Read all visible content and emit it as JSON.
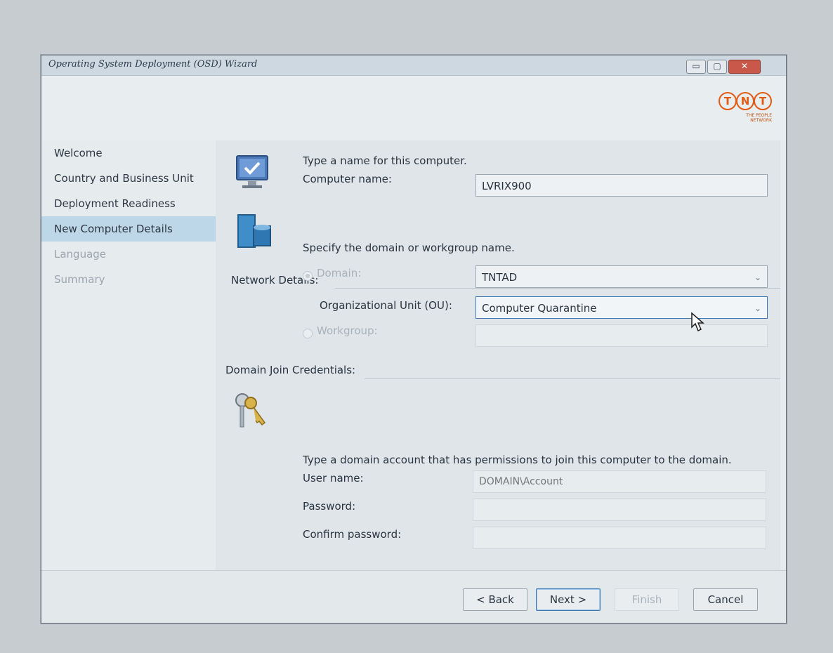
{
  "window": {
    "title": "Operating System Deployment (OSD) Wizard",
    "controls": {
      "minimize": "▭",
      "maximize": "▢",
      "close": "✕"
    }
  },
  "brand": {
    "letters": [
      "T",
      "N",
      "T"
    ],
    "tagline_1": "THE PEOPLE",
    "tagline_2": "NETWORK",
    "color": "#e25b14"
  },
  "nav": {
    "items": [
      {
        "label": "Welcome",
        "state": "normal"
      },
      {
        "label": "Country and Business Unit",
        "state": "normal"
      },
      {
        "label": "Deployment Readiness",
        "state": "normal"
      },
      {
        "label": "New Computer Details",
        "state": "active"
      },
      {
        "label": "Language",
        "state": "disabled"
      },
      {
        "label": "Summary",
        "state": "disabled"
      }
    ]
  },
  "computer": {
    "prompt": "Type a name for this computer.",
    "name_label": "Computer name:",
    "name_value": "LVRIX900",
    "icon": "monitor-check-icon"
  },
  "network": {
    "section_label": "Network Details:",
    "prompt": "Specify the domain or workgroup name.",
    "domain_label": "Domain:",
    "domain_value": "TNTAD",
    "ou_label": "Organizational Unit (OU):",
    "ou_value": "Computer Quarantine",
    "workgroup_label": "Workgroup:",
    "workgroup_value": "",
    "icon": "network-server-icon",
    "selected": "domain"
  },
  "credentials": {
    "section_label": "Domain Join Credentials:",
    "prompt": "Type a domain account that has permissions to join this computer to the domain.",
    "username_label": "User name:",
    "username_placeholder": "DOMAIN\\Account",
    "password_label": "Password:",
    "confirm_label": "Confirm password:",
    "icon": "keys-icon"
  },
  "footer": {
    "back": "< Back",
    "next": "Next >",
    "finish": "Finish",
    "cancel": "Cancel"
  },
  "colors": {
    "accent": "#3d7ab8",
    "nav_active_bg": "#bdd6e8",
    "brand_orange": "#e25b14"
  }
}
